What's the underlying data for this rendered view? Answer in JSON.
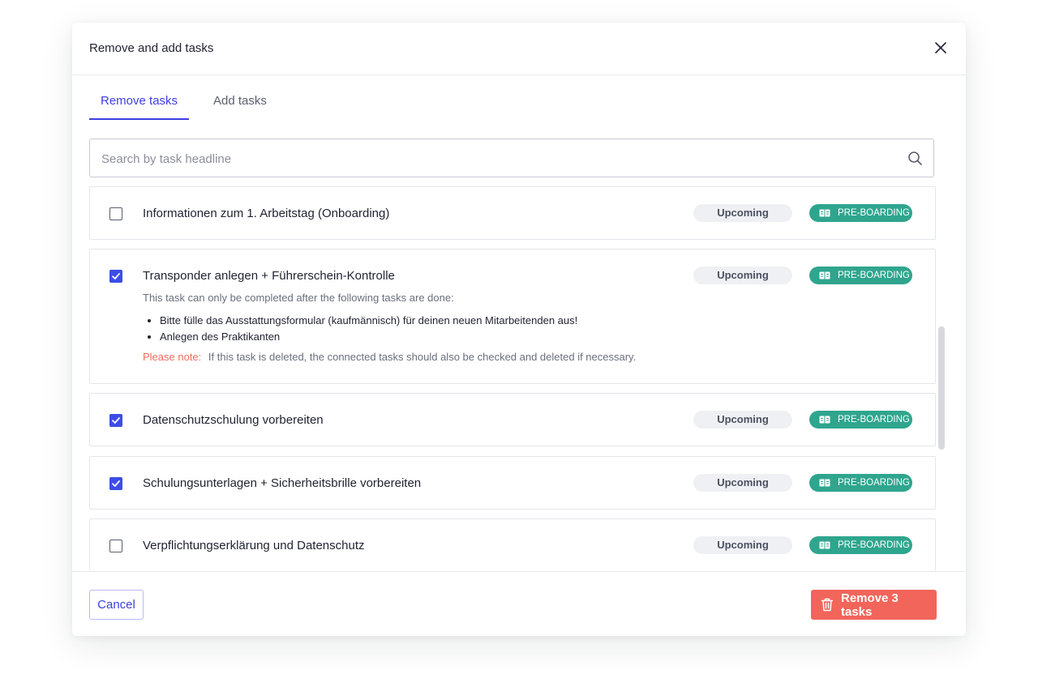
{
  "modal": {
    "title": "Remove and add tasks",
    "close_icon": "close-icon"
  },
  "tabs": [
    {
      "label": "Remove tasks",
      "active": true
    },
    {
      "label": "Add tasks",
      "active": false
    }
  ],
  "search": {
    "placeholder": "Search by task headline",
    "value": "",
    "icon": "search-icon"
  },
  "tasks": [
    {
      "title": "Informationen zum 1. Arbeitstag (Onboarding)",
      "checked": false,
      "status": "Upcoming",
      "phase": "PRE-BOARDING"
    },
    {
      "title": "Transponder anlegen + Führerschein-Kontrolle",
      "checked": true,
      "status": "Upcoming",
      "phase": "PRE-BOARDING",
      "dependency_intro": "This task can only be completed after the following tasks are done:",
      "dependencies": [
        "Bitte fülle das Ausstattungsformular (kaufmännisch) für deinen neuen Mitarbeitenden aus!",
        "Anlegen des Praktikanten"
      ],
      "note_label": "Please note:",
      "note_text": "If this task is deleted, the connected tasks should also be checked and deleted if necessary."
    },
    {
      "title": "Datenschutzschulung vorbereiten",
      "checked": true,
      "status": "Upcoming",
      "phase": "PRE-BOARDING"
    },
    {
      "title": "Schulungsunterlagen + Sicherheitsbrille vorbereiten",
      "checked": true,
      "status": "Upcoming",
      "phase": "PRE-BOARDING"
    },
    {
      "title": "Verpflichtungserklärung und Datenschutz",
      "checked": false,
      "status": "Upcoming",
      "phase": "PRE-BOARDING"
    }
  ],
  "footer": {
    "cancel_label": "Cancel",
    "remove_label": "Remove 3 tasks",
    "remove_icon": "trash-icon"
  },
  "colors": {
    "accent": "#3c3fe0",
    "checkbox": "#3c4de5",
    "phase_badge": "#2fa58e",
    "danger": "#f2655b",
    "status_badge_bg": "#eff0f4"
  }
}
